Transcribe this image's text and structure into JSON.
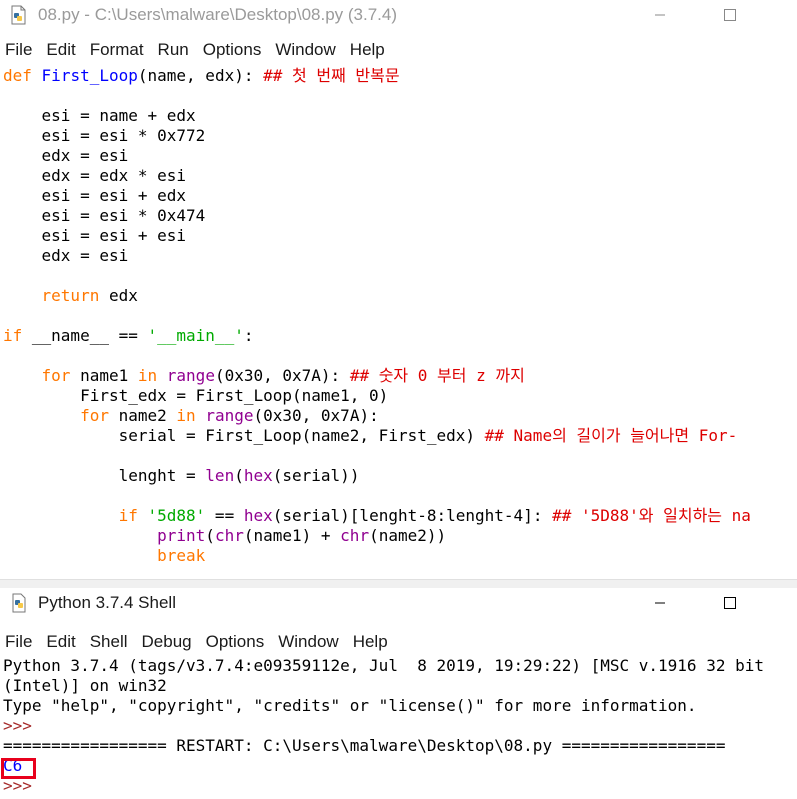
{
  "editor": {
    "title": "08.py - C:\\Users\\malware\\Desktop\\08.py (3.7.4)",
    "menu": [
      "File",
      "Edit",
      "Format",
      "Run",
      "Options",
      "Window",
      "Help"
    ],
    "lines": [
      [
        [
          "df",
          "def"
        ],
        [
          "n",
          " "
        ],
        [
          "fn",
          "First_Loop"
        ],
        [
          "n",
          "(name, edx): "
        ],
        [
          "cm",
          "## 첫 번째 반복문"
        ]
      ],
      [],
      [
        [
          "n",
          "    esi = name + edx"
        ]
      ],
      [
        [
          "n",
          "    esi = esi * 0x772"
        ]
      ],
      [
        [
          "n",
          "    edx = esi"
        ]
      ],
      [
        [
          "n",
          "    edx = edx * esi"
        ]
      ],
      [
        [
          "n",
          "    esi = esi + edx"
        ]
      ],
      [
        [
          "n",
          "    esi = esi * 0x474"
        ]
      ],
      [
        [
          "n",
          "    esi = esi + esi"
        ]
      ],
      [
        [
          "n",
          "    edx = esi"
        ]
      ],
      [],
      [
        [
          "n",
          "    "
        ],
        [
          "kw",
          "return"
        ],
        [
          "n",
          " edx"
        ]
      ],
      [],
      [
        [
          "kw",
          "if"
        ],
        [
          "n",
          " __name__ == "
        ],
        [
          "st",
          "'__main__'"
        ],
        [
          "n",
          ":"
        ]
      ],
      [],
      [
        [
          "n",
          "    "
        ],
        [
          "kw",
          "for"
        ],
        [
          "n",
          " name1 "
        ],
        [
          "kw",
          "in"
        ],
        [
          "n",
          " "
        ],
        [
          "bi",
          "range"
        ],
        [
          "n",
          "(0x30, 0x7A): "
        ],
        [
          "cm",
          "## 숫자 0 부터 z 까지"
        ]
      ],
      [
        [
          "n",
          "        First_edx = First_Loop(name1, 0)"
        ]
      ],
      [
        [
          "n",
          "        "
        ],
        [
          "kw",
          "for"
        ],
        [
          "n",
          " name2 "
        ],
        [
          "kw",
          "in"
        ],
        [
          "n",
          " "
        ],
        [
          "bi",
          "range"
        ],
        [
          "n",
          "(0x30, 0x7A):"
        ]
      ],
      [
        [
          "n",
          "            serial = First_Loop(name2, First_edx) "
        ],
        [
          "cm",
          "## Name의 길이가 늘어나면 For-"
        ]
      ],
      [],
      [
        [
          "n",
          "            lenght = "
        ],
        [
          "bi",
          "len"
        ],
        [
          "n",
          "("
        ],
        [
          "bi",
          "hex"
        ],
        [
          "n",
          "(serial))"
        ]
      ],
      [],
      [
        [
          "n",
          "            "
        ],
        [
          "kw",
          "if"
        ],
        [
          "n",
          " "
        ],
        [
          "st",
          "'5d88'"
        ],
        [
          "n",
          " == "
        ],
        [
          "bi",
          "hex"
        ],
        [
          "n",
          "(serial)[lenght-8:lenght-4]: "
        ],
        [
          "cm",
          "## '5D88'와 일치하는 na"
        ]
      ],
      [
        [
          "n",
          "                "
        ],
        [
          "bi",
          "print"
        ],
        [
          "n",
          "("
        ],
        [
          "bi",
          "chr"
        ],
        [
          "n",
          "(name1) + "
        ],
        [
          "bi",
          "chr"
        ],
        [
          "n",
          "(name2))"
        ]
      ],
      [
        [
          "n",
          "                "
        ],
        [
          "kw",
          "break"
        ]
      ]
    ]
  },
  "shell": {
    "title": "Python 3.7.4 Shell",
    "menu": [
      "File",
      "Edit",
      "Shell",
      "Debug",
      "Options",
      "Window",
      "Help"
    ],
    "lines": [
      [
        [
          "n",
          "Python 3.7.4 (tags/v3.7.4:e09359112e, Jul  8 2019, 19:29:22) [MSC v.1916 32 bit"
        ]
      ],
      [
        [
          "n",
          "(Intel)] on win32"
        ]
      ],
      [
        [
          "n",
          "Type \"help\", \"copyright\", \"credits\" or \"license()\" for more information."
        ]
      ],
      [
        [
          "pr",
          ">>> "
        ]
      ],
      [
        [
          "n",
          "================= RESTART: C:\\Users\\malware\\Desktop\\08.py ================="
        ]
      ],
      [
        [
          "out",
          "C6"
        ]
      ],
      [
        [
          "pr",
          ">>> "
        ]
      ]
    ]
  },
  "colors": {
    "keyword": "#ff7700",
    "builtin": "#900090",
    "def_name": "#0000ff",
    "string": "#00aa00",
    "comment": "#dd0000",
    "output": "#0000ff",
    "highlight_box": "#e8001c"
  },
  "icons": {
    "editor_icon": "python-file-icon",
    "shell_icon": "python-shell-icon",
    "minimize": "minimize-icon",
    "maximize": "maximize-icon"
  }
}
